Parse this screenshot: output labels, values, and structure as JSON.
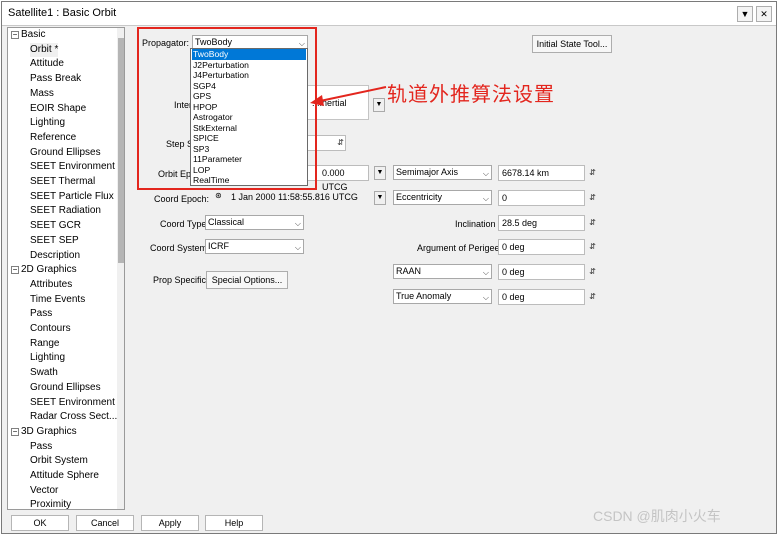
{
  "window": {
    "title": "Satellite1 : Basic Orbit",
    "menu_icon": "chevron-down",
    "close_icon": "close"
  },
  "tree": {
    "items": [
      {
        "label": "Basic",
        "type": "cat"
      },
      {
        "label": "Orbit *",
        "type": "child",
        "selected": true
      },
      {
        "label": "Attitude",
        "type": "child"
      },
      {
        "label": "Pass Break",
        "type": "child"
      },
      {
        "label": "Mass",
        "type": "child"
      },
      {
        "label": "EOIR Shape",
        "type": "child"
      },
      {
        "label": "Lighting",
        "type": "child"
      },
      {
        "label": "Reference",
        "type": "child"
      },
      {
        "label": "Ground Ellipses",
        "type": "child"
      },
      {
        "label": "SEET Environment",
        "type": "child"
      },
      {
        "label": "SEET Thermal",
        "type": "child"
      },
      {
        "label": "SEET Particle Flux",
        "type": "child"
      },
      {
        "label": "SEET Radiation",
        "type": "child"
      },
      {
        "label": "SEET GCR",
        "type": "child"
      },
      {
        "label": "SEET SEP",
        "type": "child"
      },
      {
        "label": "Description",
        "type": "child"
      },
      {
        "label": "2D Graphics",
        "type": "cat"
      },
      {
        "label": "Attributes",
        "type": "child"
      },
      {
        "label": "Time Events",
        "type": "child"
      },
      {
        "label": "Pass",
        "type": "child"
      },
      {
        "label": "Contours",
        "type": "child"
      },
      {
        "label": "Range",
        "type": "child"
      },
      {
        "label": "Lighting",
        "type": "child"
      },
      {
        "label": "Swath",
        "type": "child"
      },
      {
        "label": "Ground Ellipses",
        "type": "child"
      },
      {
        "label": "SEET Environment",
        "type": "child"
      },
      {
        "label": "Radar Cross Sect...",
        "type": "child"
      },
      {
        "label": "3D Graphics",
        "type": "cat"
      },
      {
        "label": "Pass",
        "type": "child"
      },
      {
        "label": "Orbit System",
        "type": "child"
      },
      {
        "label": "Attitude Sphere",
        "type": "child"
      },
      {
        "label": "Vector",
        "type": "child"
      },
      {
        "label": "Proximity",
        "type": "child"
      }
    ]
  },
  "form": {
    "propagator_label": "Propagator:",
    "propagator_value": "TwoBody",
    "initial_state_button": "Initial State Tool...",
    "integrator_label": "Inter",
    "integrator_value": "...Inertial",
    "step_size_label": "Step Si",
    "orbit_epoch_label": "Orbit Epo",
    "orbit_epoch_value": "0.000 UTCG",
    "coord_epoch_label": "Coord Epoch:",
    "coord_epoch_value": "1 Jan 2000 11:58:55.816 UTCG",
    "coord_type_label": "Coord Type:",
    "coord_type_value": "Classical",
    "coord_system_label": "Coord System:",
    "coord_system_value": "ICRF",
    "prop_specific_label": "Prop Specific:",
    "special_options_button": "Special Options...",
    "semimajor_select": "Semimajor Axis",
    "semimajor_value": "6678.14 km",
    "eccentricity_select": "Eccentricity",
    "eccentricity_value": "0",
    "inclination_label": "Inclination",
    "inclination_value": "28.5 deg",
    "arg_perigee_label": "Argument of Perigee",
    "arg_perigee_value": "0 deg",
    "raan_select": "RAAN",
    "raan_value": "0 deg",
    "anomaly_select": "True Anomaly",
    "anomaly_value": "0 deg"
  },
  "propagator_options": [
    "TwoBody",
    "J2Perturbation",
    "J4Perturbation",
    "SGP4",
    "GPS",
    "HPOP",
    "Astrogator",
    "StkExternal",
    "SPICE",
    "SP3",
    "11Parameter",
    "LOP",
    "RealTime"
  ],
  "annotation": "轨道外推算法设置",
  "buttons": {
    "ok": "OK",
    "cancel": "Cancel",
    "apply": "Apply",
    "help": "Help"
  },
  "watermark": "CSDN @肌肉小火车",
  "colors": {
    "highlight": "#0078d7",
    "annotation": "#e3261e"
  }
}
